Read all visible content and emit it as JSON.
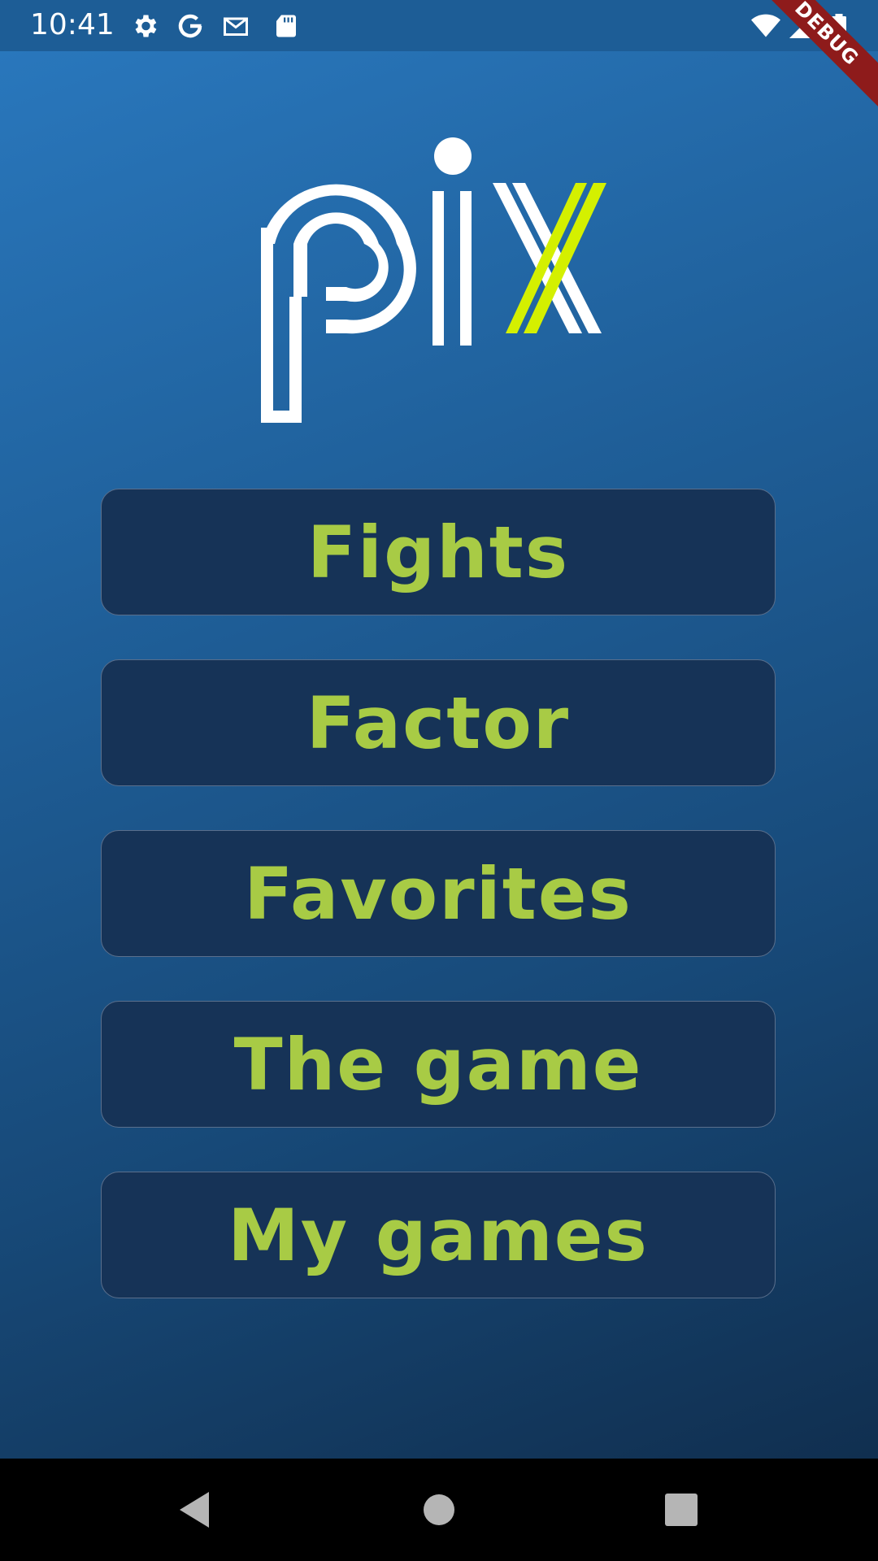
{
  "status_bar": {
    "time": "10:41",
    "left_icons": [
      "gear-icon",
      "google-icon",
      "gmail-icon",
      "sd-card-icon"
    ],
    "right_icons": [
      "wifi-icon",
      "signal-icon",
      "battery-icon"
    ]
  },
  "debug_banner": "DEBUG",
  "logo": {
    "text": "pix",
    "accent_color": "#d4f000"
  },
  "menu": {
    "items": [
      {
        "label": "Fights"
      },
      {
        "label": "Factor"
      },
      {
        "label": "Favorites"
      },
      {
        "label": "The game"
      },
      {
        "label": "My games"
      }
    ]
  },
  "colors": {
    "background_top": "#2a79bf",
    "background_bottom": "#0f2a48",
    "button_fill": "#163357",
    "button_text": "#a8cb45"
  },
  "nav_bar": {
    "buttons": [
      "back-icon",
      "home-icon",
      "recents-icon"
    ]
  }
}
